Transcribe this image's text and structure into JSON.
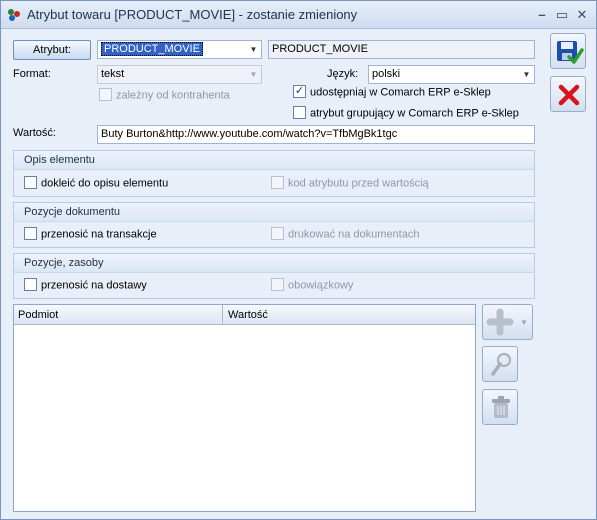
{
  "window": {
    "title": "Atrybut towaru [PRODUCT_MOVIE] - zostanie zmieniony"
  },
  "form": {
    "atrybut_button": "Atrybut:",
    "atrybut_code": "PRODUCT_MOVIE",
    "atrybut_name": "PRODUCT_MOVIE",
    "format_label": "Format:",
    "format_value": "tekst",
    "jezyk_label": "Język:",
    "jezyk_value": "polski",
    "zalezny_label": "zależny od kontrahenta",
    "udostepniaj_label": "udostępniaj w Comarch ERP e-Sklep",
    "udostepniaj_checked": true,
    "grupujacy_label": "atrybut grupujący w Comarch ERP e-Sklep",
    "wartosc_label": "Wartość:",
    "wartosc_value": "Buty Burton&http://www.youtube.com/watch?v=TfbMgBk1tgc"
  },
  "groups": {
    "opis": {
      "title": "Opis elementu",
      "left_label": "dokleić do opisu elementu",
      "right_label": "kod atrybutu przed wartością"
    },
    "dokument": {
      "title": "Pozycje dokumentu",
      "left_label": "przenosić na transakcje",
      "right_label": "drukować na dokumentach"
    },
    "zasoby": {
      "title": "Pozycje, zasoby",
      "left_label": "przenosić na dostawy",
      "right_label": "obowiązkowy"
    }
  },
  "grid": {
    "columns": [
      "Podmiot",
      "Wartość"
    ],
    "rows": []
  },
  "icons": {
    "app": "attribute-app-icon",
    "save": "save-disk-icon",
    "cancel": "cancel-x-icon",
    "add": "plus-icon",
    "edit": "magnifier-icon",
    "delete": "trash-icon"
  },
  "colors": {
    "accent": "#3162c4",
    "cancel_red": "#d8141e",
    "save_blue": "#1d4fa8"
  }
}
